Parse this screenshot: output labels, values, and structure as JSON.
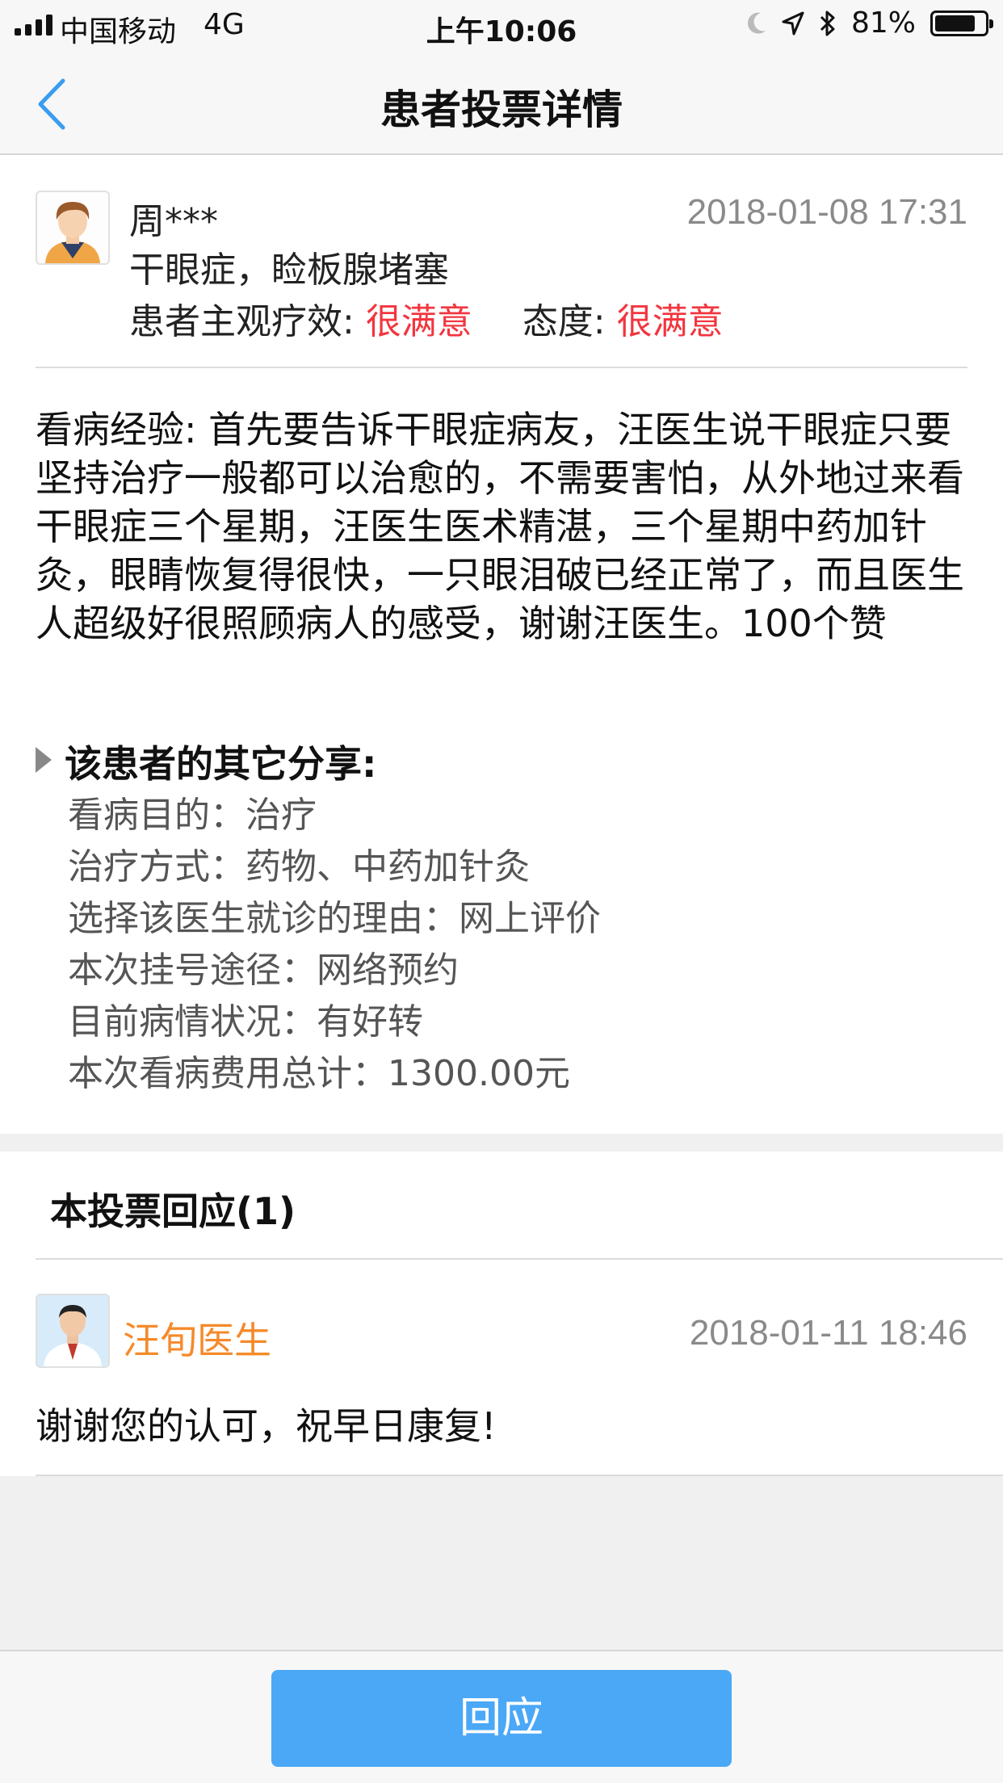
{
  "status_bar": {
    "carrier": "中国移动",
    "network": "4G",
    "time": "上午10:06",
    "battery": "81%",
    "battery_level": 0.81,
    "icons": [
      "moon-icon",
      "location-icon",
      "bluetooth-icon",
      "battery-icon"
    ]
  },
  "nav": {
    "title": "患者投票详情",
    "back_icon": "chevron-left-icon"
  },
  "post": {
    "patient_name": "周***",
    "date": "2018-01-08 17:31",
    "diagnosis": "干眼症，睑板腺堵塞",
    "effect_label": "患者主观疗效: ",
    "effect_value": "很满意",
    "attitude_label": "态度: ",
    "attitude_value": "很满意",
    "experience": "看病经验: 首先要告诉干眼症病友，汪医生说干眼症只要坚持治疗一般都可以治愈的，不需要害怕，从外地过来看干眼症三个星期，汪医生医术精湛，三个星期中药加针灸，眼睛恢复得很快，一只眼泪破已经正常了，而且医生人超级好很照顾病人的感受，谢谢汪医生。100个赞",
    "others_title": "该患者的其它分享:",
    "others": [
      "看病目的：治疗",
      "治疗方式：药物、中药加针灸",
      "选择该医生就诊的理由：网上评价",
      "本次挂号途径：网络预约",
      "目前病情状况：有好转",
      "本次看病费用总计：1300.00元"
    ]
  },
  "responses": {
    "heading": "本投票回应(1)",
    "doctor_name": "汪旬医生",
    "date": "2018-01-11 18:46",
    "text": "谢谢您的认可，祝早日康复!"
  },
  "bottom": {
    "reply_button": "回应"
  },
  "colors": {
    "accent_blue": "#4aa8f7",
    "rating_red": "#f2363f",
    "doctor_orange": "#f58a2a"
  }
}
